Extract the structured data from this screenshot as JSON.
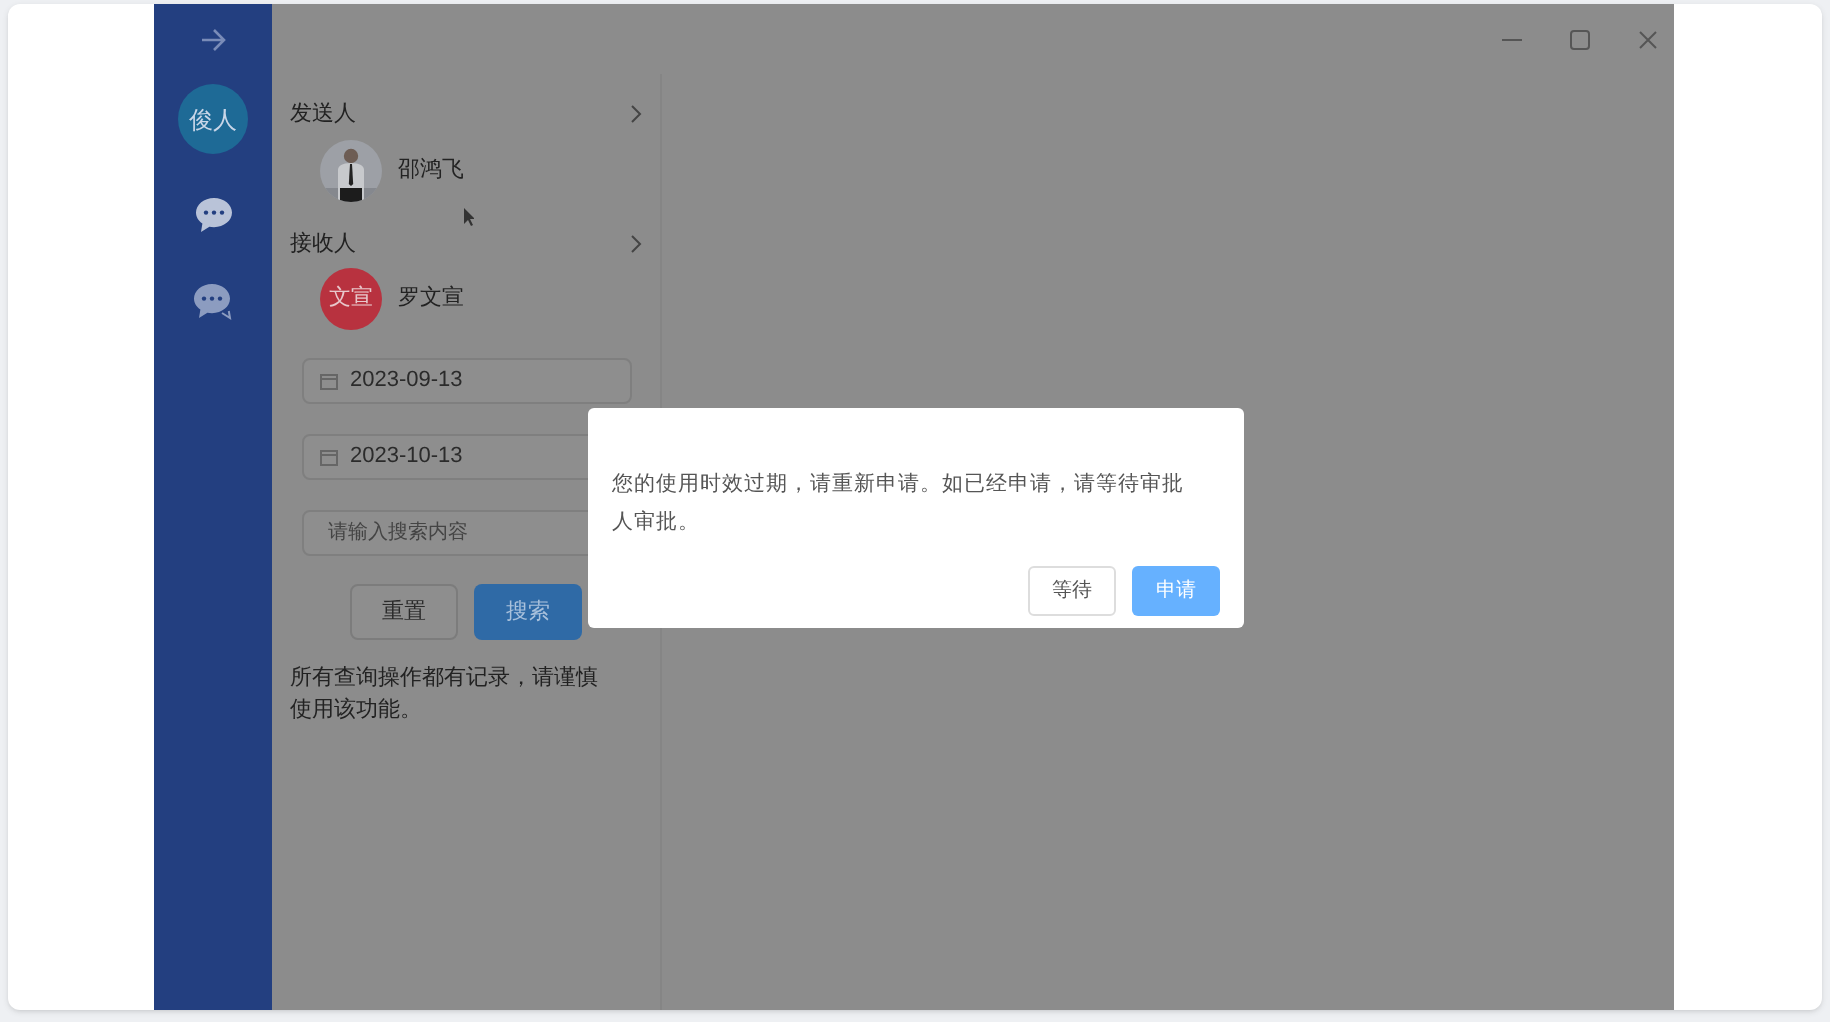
{
  "sidebar": {
    "user_avatar": "俊人"
  },
  "sender": {
    "label": "发送人",
    "name": "邵鸿飞"
  },
  "receiver": {
    "label": "接收人",
    "name": "罗文宣",
    "avatar": {
      "kind": "initials",
      "text": "文宣"
    }
  },
  "start_date": {
    "value": "2023-09-13"
  },
  "end_date": {
    "value": "2023-10-13"
  },
  "search": {
    "placeholder": "请输入搜索内容"
  },
  "buttons": [
    {
      "label": "重置",
      "kind": "default"
    },
    {
      "label": "搜索",
      "kind": "primary"
    }
  ],
  "notice": "所有查询操作都有记录，请谨慎使用该功能。",
  "dialog": {
    "message": "您的使用时效过期，请重新申请。如已经申请，请等待审批人审批。",
    "buttons": [
      {
        "label": "等待",
        "kind": "default"
      },
      {
        "label": "申请",
        "kind": "primary"
      }
    ]
  }
}
